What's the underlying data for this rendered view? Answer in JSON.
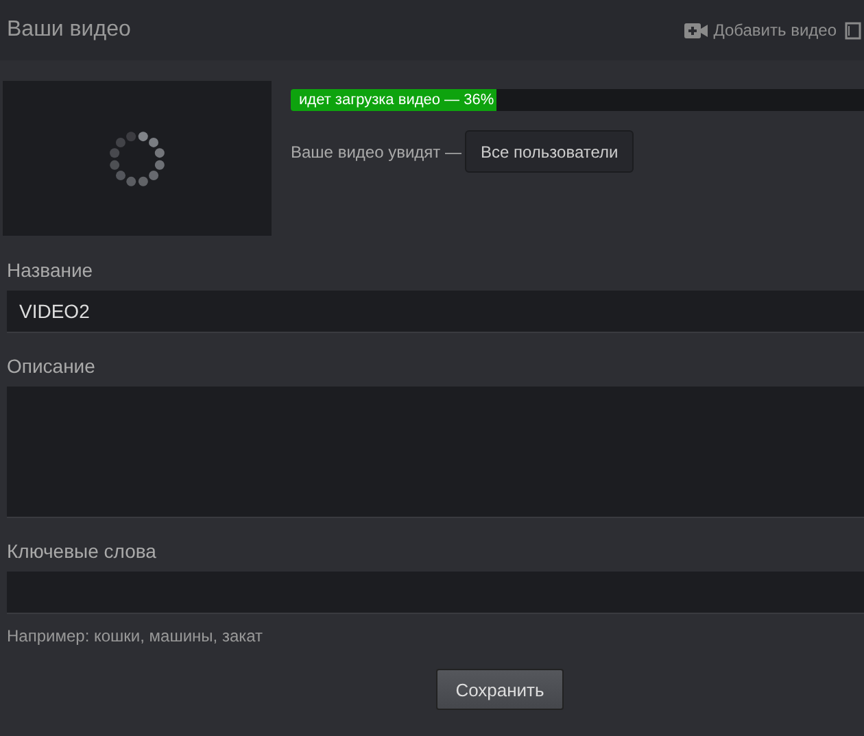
{
  "header": {
    "title": "Ваши видео",
    "add_link": "Добавить видео"
  },
  "upload": {
    "label": "идет загрузка видео — 36%",
    "level": 0.36
  },
  "visibility": {
    "label": "Ваше видео увидят —",
    "button": "Все пользователи"
  },
  "fields": [
    {
      "kind": "text",
      "label": "Название",
      "value": "VIDEO2"
    },
    {
      "kind": "textarea",
      "label": "Описание"
    },
    {
      "kind": "text",
      "label": "Ключевые слова",
      "hint": "Например: кошки, машины, закат"
    }
  ],
  "save_button": "Сохранить"
}
